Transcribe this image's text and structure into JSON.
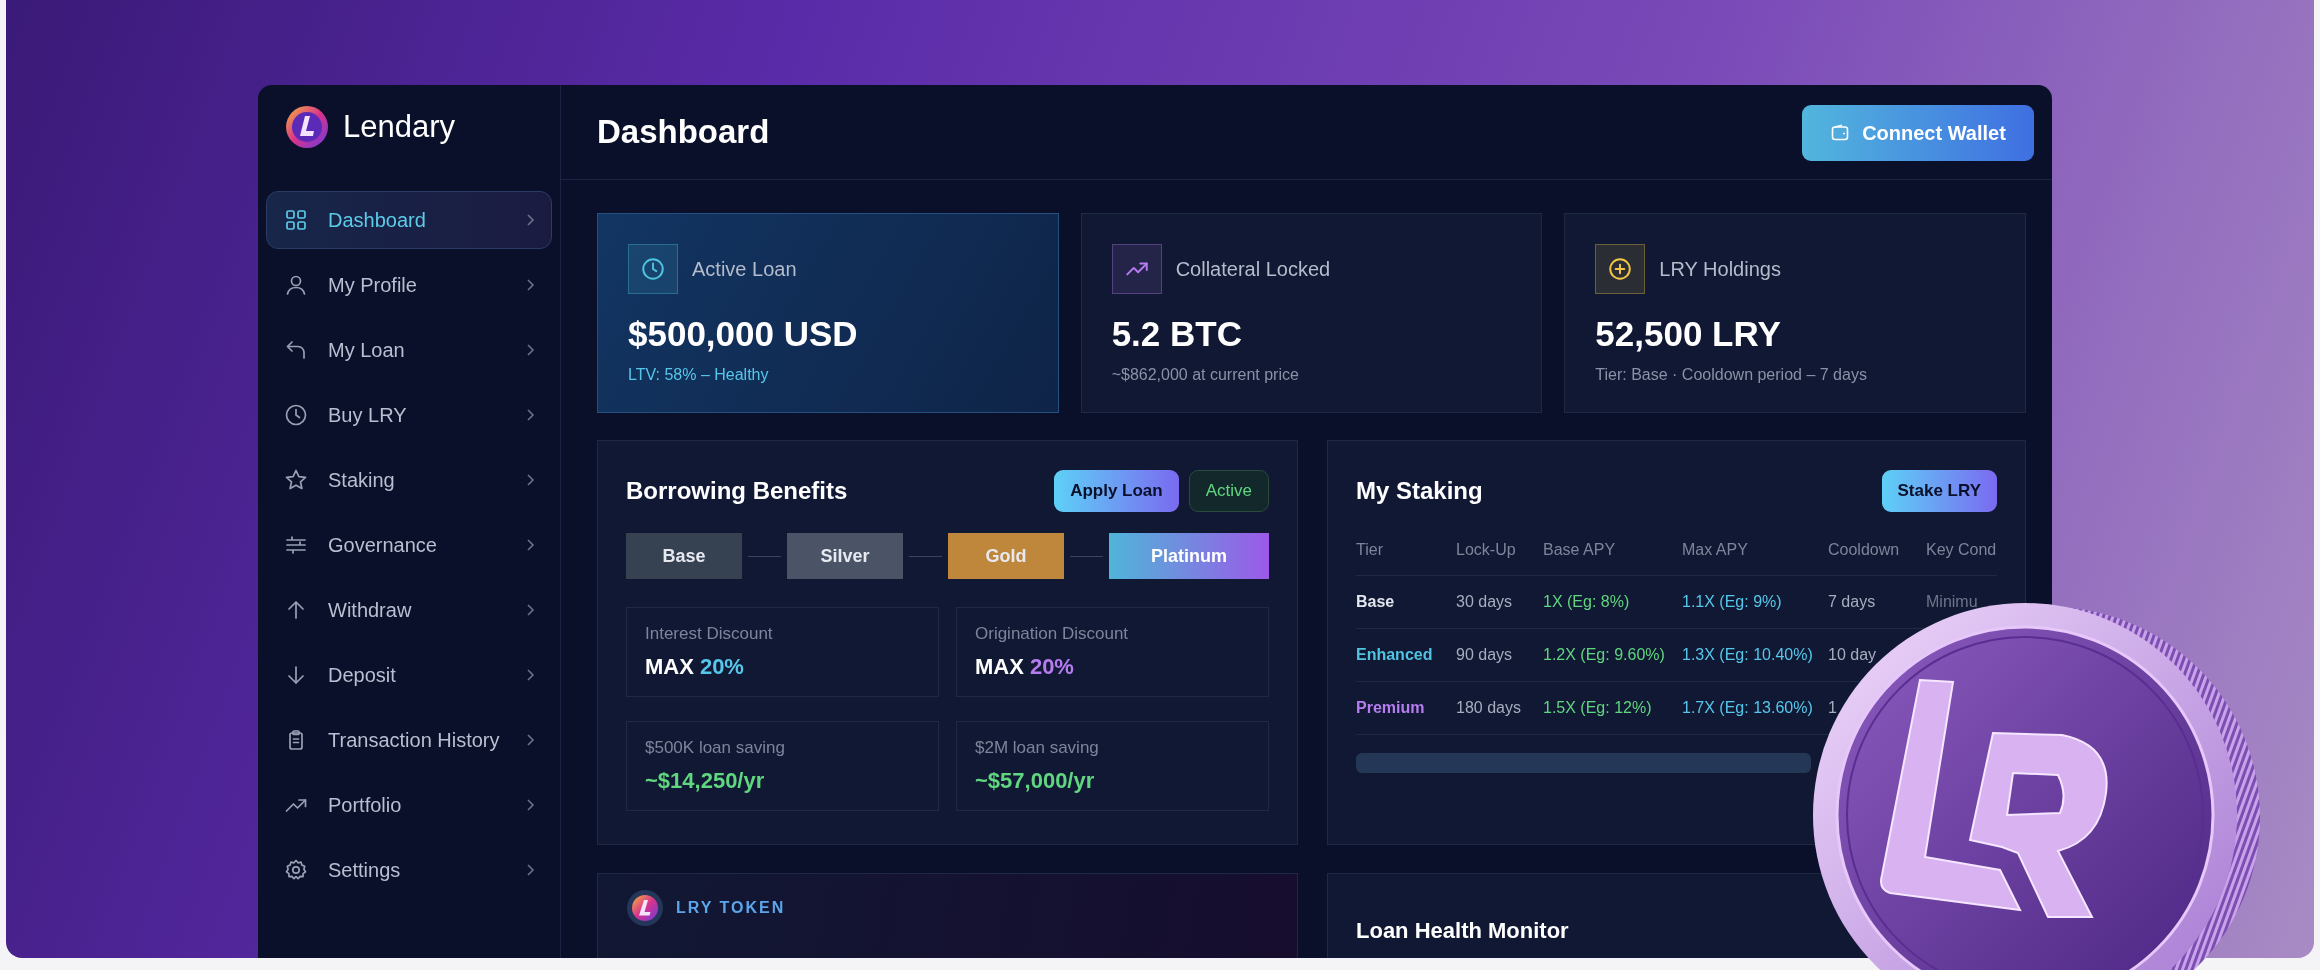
{
  "brand": {
    "name": "Lendary"
  },
  "sidebar": {
    "items": [
      {
        "label": "Dashboard",
        "kind": "grid",
        "selected": true
      },
      {
        "label": "My Profile",
        "kind": "user",
        "selected": false
      },
      {
        "label": "My Loan",
        "kind": "return",
        "selected": false
      },
      {
        "label": "Buy LRY",
        "kind": "clock",
        "selected": false
      },
      {
        "label": "Staking",
        "kind": "star",
        "selected": false
      },
      {
        "label": "Governance",
        "kind": "sliders",
        "selected": false
      },
      {
        "label": "Withdraw",
        "kind": "up",
        "selected": false
      },
      {
        "label": "Deposit",
        "kind": "down",
        "selected": false
      },
      {
        "label": "Transaction History",
        "kind": "clipboard",
        "selected": false
      },
      {
        "label": "Portfolio",
        "kind": "trend",
        "selected": false
      },
      {
        "label": "Settings",
        "kind": "gear",
        "selected": false
      }
    ]
  },
  "header": {
    "title": "Dashboard",
    "button": "Connect Wallet"
  },
  "stats": [
    {
      "kind": "clock",
      "color": "#4fc3e0",
      "title": "Active Loan",
      "value": "$500,000 USD",
      "note": "LTV: 58% – Healthy",
      "highlighted": true
    },
    {
      "kind": "trend",
      "color": "#b67cf0",
      "title": "Collateral Locked",
      "value": "5.2 BTC",
      "note": "~$862,000 at current price",
      "highlighted": false
    },
    {
      "kind": "coin",
      "color": "#f2c744",
      "title": "LRY Holdings",
      "value": "52,500 LRY",
      "note": "Tier: Base · Cooldown period – 7 days",
      "highlighted": false
    }
  ],
  "borrowing": {
    "title": "Borrowing Benefits",
    "button": "Apply Loan",
    "badge": "Active",
    "tiers": [
      {
        "label": "Base",
        "kind": "solid",
        "color": "#364152"
      },
      {
        "label": "Silver",
        "kind": "solid",
        "color": "#4a5466"
      },
      {
        "label": "Gold",
        "kind": "solid",
        "color": "#bf873b"
      },
      {
        "label": "Platinum",
        "kind": "gradient",
        "color": "#4fb5d8"
      }
    ],
    "benefits": [
      {
        "label": "Interest Discount",
        "prefix": "MAX",
        "value": "20%",
        "color": "#56c7ea"
      },
      {
        "label": "Origination Discount",
        "prefix": "MAX",
        "value": "20%",
        "color": "#b67cf0"
      },
      {
        "label": "$500K loan saving",
        "value": "~$14,250/yr",
        "color": "#5fd67f"
      },
      {
        "label": "$2M loan saving",
        "value": "~$57,000/yr",
        "color": "#5fd67f"
      }
    ]
  },
  "staking": {
    "title": "My Staking",
    "button": "Stake LRY",
    "columns": [
      "Tier",
      "Lock-Up",
      "Base APY",
      "Max APY",
      "Cooldown",
      "Key Cond"
    ],
    "rows": [
      {
        "tier": "Base",
        "color": "#e3e6ee",
        "lockup": "30 days",
        "base_apy": "1X (Eg: 8%)",
        "max_apy": "1.1X (Eg: 9%)",
        "cooldown": "7 days",
        "key_condition": "Minimu"
      },
      {
        "tier": "Enhanced",
        "color": "#4fc3e0",
        "lockup": "90 days",
        "base_apy": "1.2X (Eg: 9.60%)",
        "max_apy": "1.3X (Eg: 10.40%)",
        "cooldown": "10 day"
      },
      {
        "tier": "Premium",
        "color": "#b67cf0",
        "lockup": "180 days",
        "base_apy": "1.5X (Eg: 12%)",
        "max_apy": "1.7X (Eg: 13.60%)",
        "cooldown": "1"
      }
    ]
  },
  "token": {
    "title": "LRY TOKEN"
  },
  "health": {
    "title": "Loan Health Monitor"
  }
}
